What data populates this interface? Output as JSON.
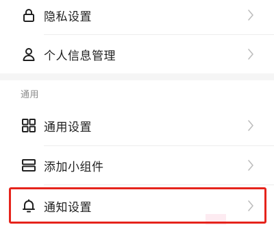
{
  "items": [
    {
      "label": "隐私设置",
      "icon": "lock-icon"
    },
    {
      "label": "个人信息管理",
      "icon": "person-icon"
    },
    {
      "label": "通用设置",
      "icon": "grid-icon"
    },
    {
      "label": "添加小组件",
      "icon": "widget-icon"
    },
    {
      "label": "通知设置",
      "icon": "bell-icon"
    }
  ],
  "section": {
    "title": "通用"
  },
  "colors": {
    "text": "#1f1f1f",
    "subtle": "#8a8a8a",
    "chevron": "#bdbdbd",
    "highlight": "#e5231b"
  }
}
